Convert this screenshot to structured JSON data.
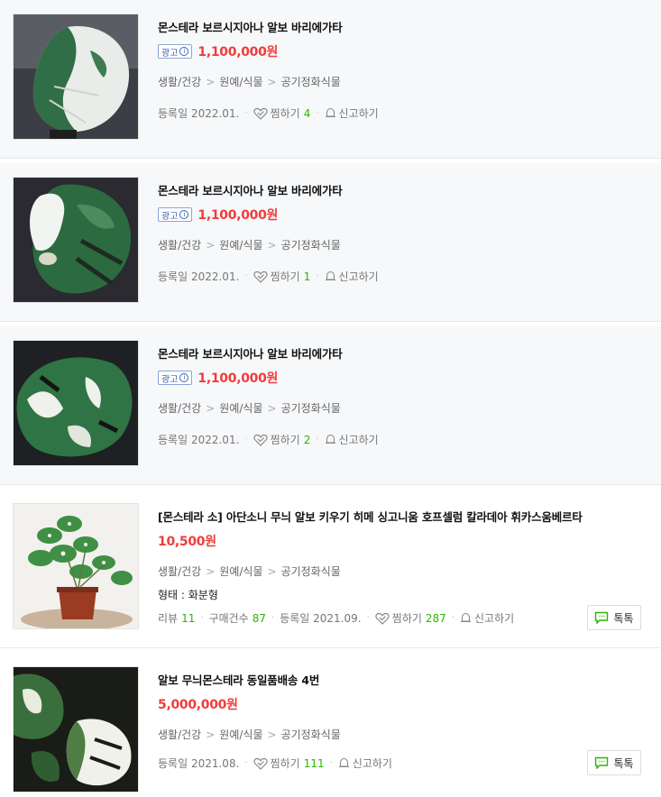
{
  "labels": {
    "ad": "광고",
    "ad_info": "i",
    "registered": "등록일",
    "wish": "찜하기",
    "report": "신고하기",
    "review": "리뷰",
    "purchases": "구매건수",
    "talk": "톡톡",
    "sep": ">"
  },
  "items": [
    {
      "title": "몬스테라 보르시지아나 알보 바리에가타",
      "price": "1,100,000원",
      "category": [
        "생활/건강",
        "원예/식물",
        "공기정화식물"
      ],
      "date": "2022.01.",
      "wish_count": "4"
    },
    {
      "title": "몬스테라 보르시지아나 알보 바리에가타",
      "price": "1,100,000원",
      "category": [
        "생활/건강",
        "원예/식물",
        "공기정화식물"
      ],
      "date": "2022.01.",
      "wish_count": "1"
    },
    {
      "title": "몬스테라 보르시지아나 알보 바리에가타",
      "price": "1,100,000원",
      "category": [
        "생활/건강",
        "원예/식물",
        "공기정화식물"
      ],
      "date": "2022.01.",
      "wish_count": "2"
    },
    {
      "title": "[몬스테라 소] 아단소니 무늬 알보 키우기 히메 싱고니움 호프셀럼 칼라데아 휘카스움베르타",
      "price": "10,500원",
      "category": [
        "생활/건강",
        "원예/식물",
        "공기정화식물"
      ],
      "spec": "형태 : 화분형",
      "review_count": "11",
      "purchase_count": "87",
      "date": "2021.09.",
      "wish_count": "287"
    },
    {
      "title": "알보 무늬몬스테라 동일품배송 4번",
      "price": "5,000,000원",
      "category": [
        "생활/건강",
        "원예/식물",
        "공기정화식물"
      ],
      "date": "2021.08.",
      "wish_count": "111"
    }
  ]
}
